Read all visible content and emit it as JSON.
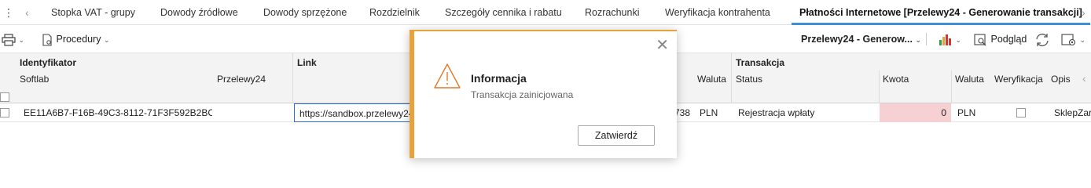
{
  "tabs": [
    {
      "label": "Stopka VAT - grupy",
      "active": false
    },
    {
      "label": "Dowody źródłowe",
      "active": false
    },
    {
      "label": "Dowody sprzężone",
      "active": false
    },
    {
      "label": "Rozdzielnik",
      "active": false
    },
    {
      "label": "Szczegóły cennika i rabatu",
      "active": false
    },
    {
      "label": "Rozrachunki",
      "active": false
    },
    {
      "label": "Weryfikacja kontrahenta",
      "active": false
    },
    {
      "label": "Płatności Internetowe [Przelewy24 - Generowanie transakcji]",
      "active": true
    }
  ],
  "toolbar": {
    "procedury_label": "Procedury",
    "view_select_label": "Przelewy24 - Generow...",
    "podglad_label": "Podgląd"
  },
  "grid": {
    "groups": {
      "identyfikator": "Identyfikator",
      "link": "Link",
      "transakcja": "Transakcja"
    },
    "columns": {
      "softlab": "Softlab",
      "przelewy24": "Przelewy24",
      "waluta1": "Waluta",
      "status": "Status",
      "kwota": "Kwota",
      "waluta2": "Waluta",
      "weryfikacja": "Weryfikacja",
      "opis": "Opis"
    },
    "rows": [
      {
        "softlab": "EE11A6B7-F16B-49C3-8112-71F3F592B2BC",
        "przelewy24": "",
        "link": "https://sandbox.przelewy24",
        "number_tail": "738",
        "waluta1": "PLN",
        "status": "Rejestracja wpłaty",
        "kwota": "0",
        "waluta2": "PLN",
        "weryfikacja": false,
        "opis": "SklepZar"
      }
    ]
  },
  "dialog": {
    "title": "Informacja",
    "message": "Transakcja zainicjowana",
    "confirm_label": "Zatwierdź",
    "accent_color": "#e8a23a",
    "icon": "warning-triangle-icon"
  },
  "colors": {
    "active_tab_underline": "#3d8fd6",
    "kwota_highlight": "#f6d0d3",
    "link_focus_border": "#2a6bd1"
  }
}
